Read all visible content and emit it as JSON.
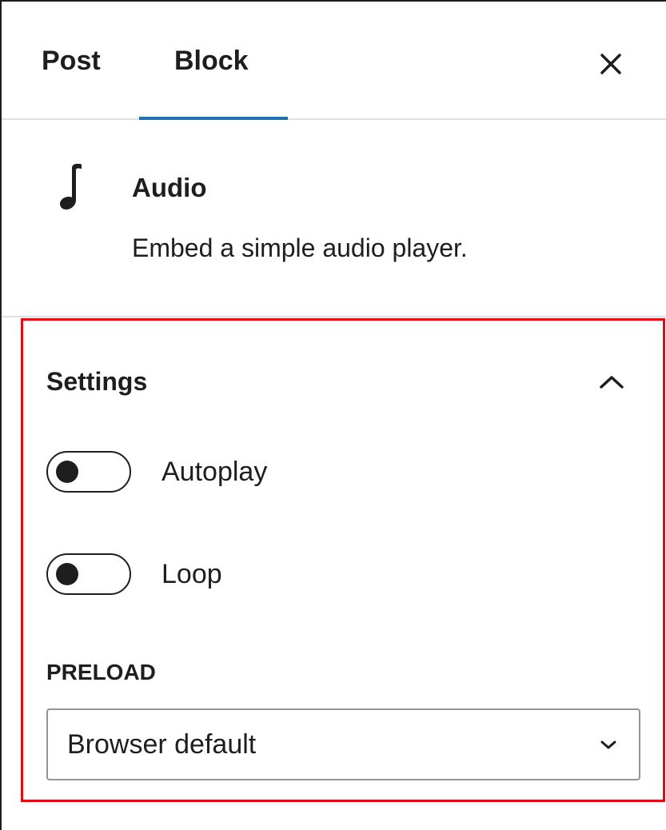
{
  "tabs": [
    {
      "label": "Post",
      "active": false
    },
    {
      "label": "Block",
      "active": true
    }
  ],
  "header": {
    "close_icon": "close-icon",
    "accent_color": "#2271b1"
  },
  "block": {
    "icon": "music-note-icon",
    "title": "Audio",
    "description": "Embed a simple audio player."
  },
  "settings": {
    "title": "Settings",
    "collapse_icon": "chevron-up-icon",
    "highlight_color": "#e50914",
    "toggles": [
      {
        "label": "Autoplay",
        "checked": false
      },
      {
        "label": "Loop",
        "checked": false
      }
    ],
    "preload": {
      "label": "PRELOAD",
      "selected": "Browser default",
      "icon": "chevron-down-icon"
    }
  }
}
